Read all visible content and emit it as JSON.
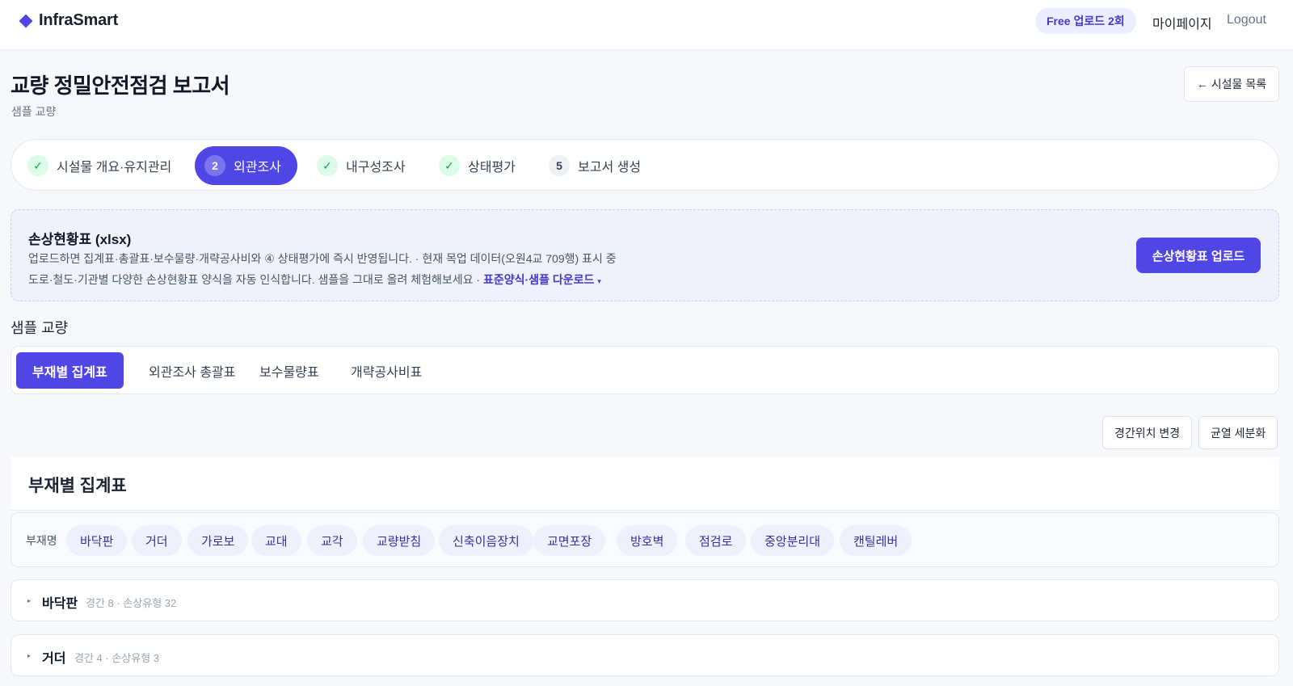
{
  "header": {
    "brand": "InfraSmart",
    "free_badge": "Free 업로드 2회",
    "mypage": "마이페이지",
    "logout": "Logout"
  },
  "page": {
    "title": "교량 정밀안전점검 보고서",
    "subtitle": "샘플 교량",
    "back_button": "← 시설물 목록"
  },
  "steps": [
    {
      "label": "시설물 개요·유지관리",
      "marker": "✓",
      "state": "done"
    },
    {
      "label": "외관조사",
      "marker": "2",
      "state": "active"
    },
    {
      "label": "내구성조사",
      "marker": "✓",
      "state": "done"
    },
    {
      "label": "상태평가",
      "marker": "✓",
      "state": "done"
    },
    {
      "label": "보고서 생성",
      "marker": "5",
      "state": "pending"
    }
  ],
  "upload": {
    "title": "손상현황표 (xlsx)",
    "line1": "업로드하면 집계표·총괄표·보수물량·개략공사비와 ④ 상태평가에 즉시 반영됩니다. · 현재 목업 데이터(오원4교 709행) 표시 중",
    "line2": "도로·철도·기관별 다양한 손상현황표 양식을 자동 인식합니다. 샘플을 그대로 올려 체험해보세요 ·",
    "link": "표준양식·샘플 다운로드",
    "link_caret": "▾",
    "button": "손상현황표 업로드"
  },
  "section_label": "샘플 교량",
  "tabs": [
    {
      "label": "부재별 집계표",
      "active": true
    },
    {
      "label": "외관조사 총괄표",
      "active": false
    },
    {
      "label": "보수물량표",
      "active": false
    },
    {
      "label": "개략공사비표",
      "active": false
    }
  ],
  "actions": {
    "span_position": "경간위치 변경",
    "crack_detail": "균열 세분화"
  },
  "summary": {
    "title": "부재별 집계표",
    "filter_label": "부재명",
    "members": [
      "바닥판",
      "거더",
      "가로보",
      "교대",
      "교각",
      "교량받침",
      "신축이음장치",
      "교면포장",
      "방호벽",
      "점검로",
      "중앙분리대",
      "캔틸레버"
    ]
  },
  "groups": [
    {
      "name": "바닥판",
      "meta": "경간 8 · 손상유형 32"
    },
    {
      "name": "거더",
      "meta": "경간 4 · 손상유형 3"
    }
  ],
  "colors": {
    "accent": "#4f46e5",
    "done": "#16a34a",
    "background": "#f7f8fc"
  }
}
